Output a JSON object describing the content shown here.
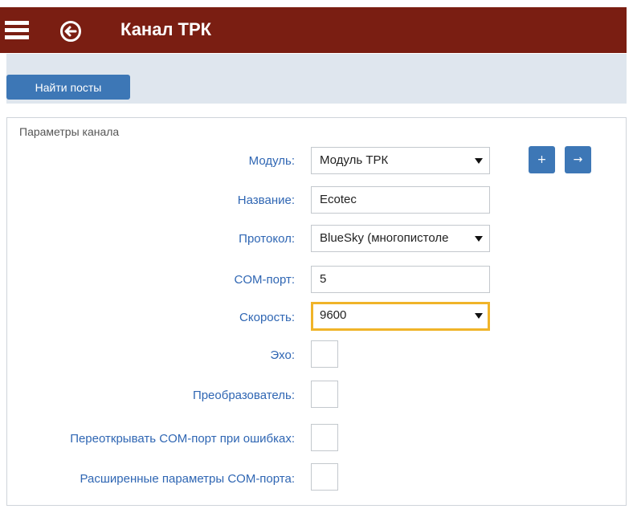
{
  "header": {
    "title": "Канал ТРК",
    "menu_icon": "hamburger-menu-icon",
    "back_icon": "back-arrow-circle-icon",
    "bg_color": "#7a1e12"
  },
  "toolbar": {
    "find_posts_label": "Найти посты"
  },
  "panel": {
    "title": "Параметры канала",
    "add_label": "+",
    "go_label": "→",
    "fields": {
      "module": {
        "label": "Модуль:",
        "value": "Модуль ТРК"
      },
      "name": {
        "label": "Название:",
        "value": "Ecotec"
      },
      "protocol": {
        "label": "Протокол:",
        "value": "BlueSky (многопистоле"
      },
      "com_port": {
        "label": "COM-порт:",
        "value": "5"
      },
      "speed": {
        "label": "Скорость:",
        "value": "9600"
      },
      "echo": {
        "label": "Эхо:"
      },
      "converter": {
        "label": "Преобразователь:"
      },
      "reopen": {
        "label": "Переоткрывать COM-порт при ошибках:"
      },
      "extended": {
        "label": "Расширенные параметры COM-порта:"
      }
    }
  },
  "colors": {
    "accent": "#3d77b6",
    "label": "#2f66b3",
    "focus": "#f0b429"
  }
}
